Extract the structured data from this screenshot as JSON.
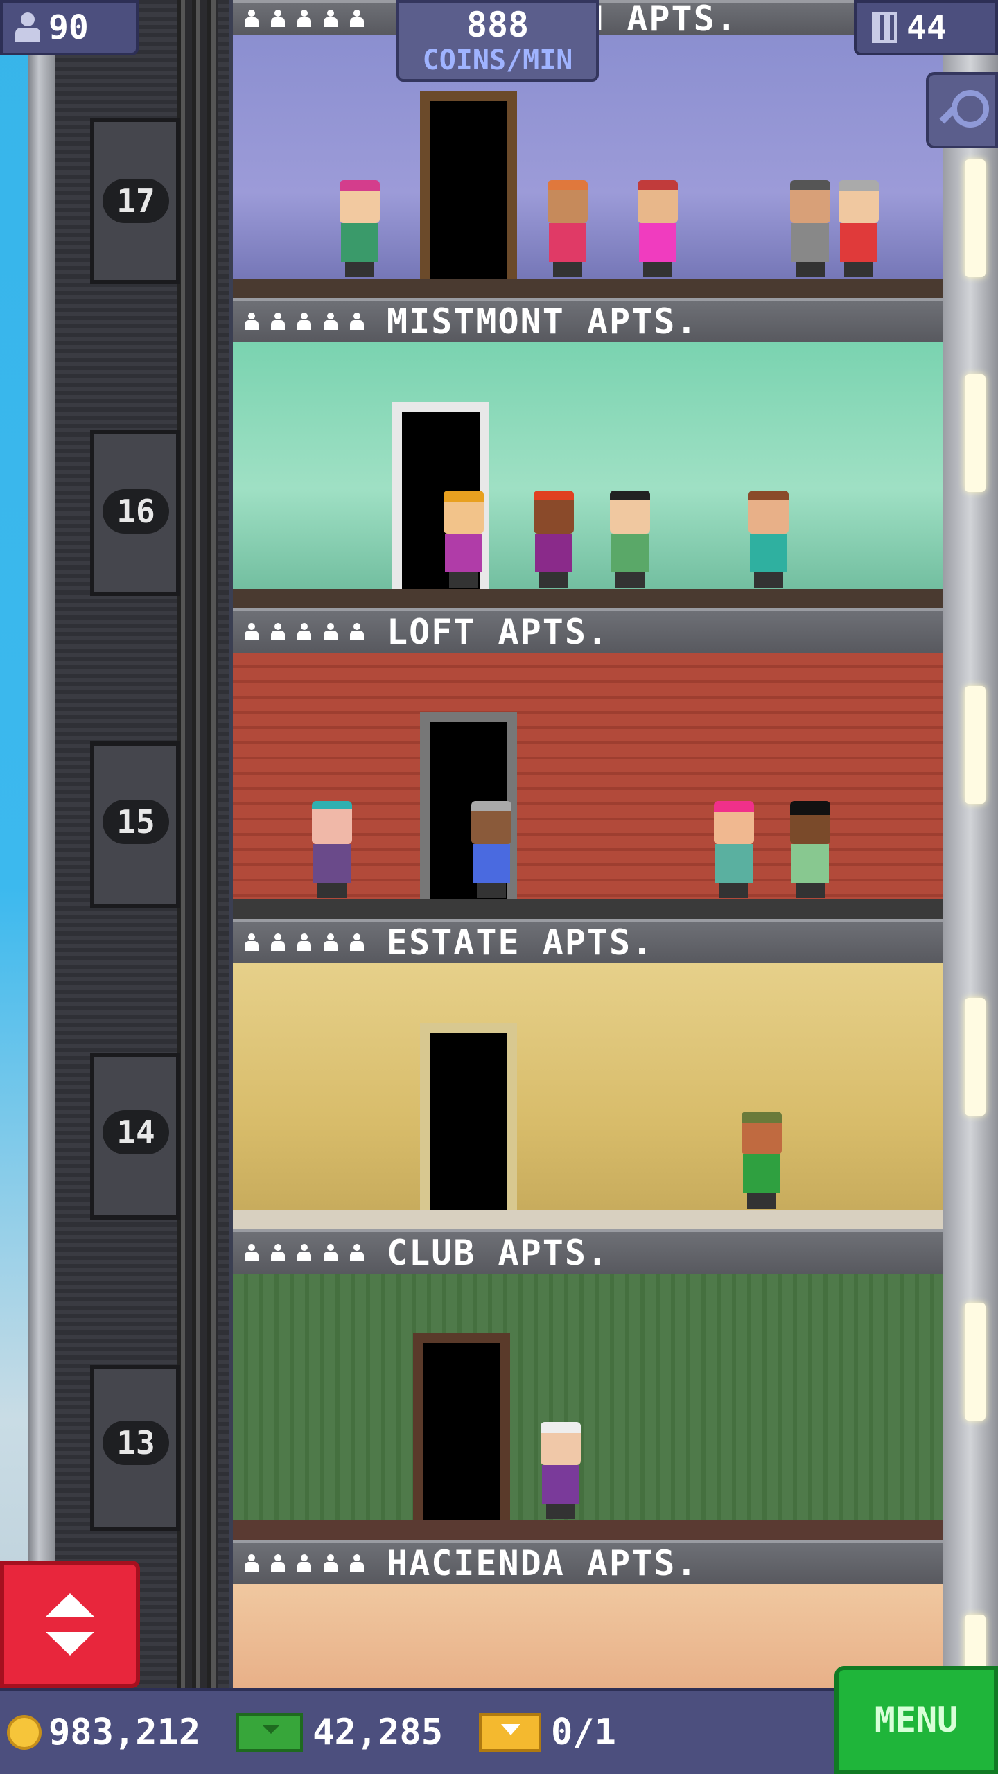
{
  "hud": {
    "population": "90",
    "coins_per_min_value": "888",
    "coins_per_min_label": "COINS/MIN",
    "floor_count": "44"
  },
  "top_floor_partial_name": "WN APTS.",
  "floors": [
    {
      "number": "17",
      "name": "MISTMONT APTS."
    },
    {
      "number": "16",
      "name": "LOFT APTS."
    },
    {
      "number": "15",
      "name": "ESTATE APTS."
    },
    {
      "number": "14",
      "name": "CLUB APTS."
    },
    {
      "number": "13",
      "name": "HACIENDA APTS."
    }
  ],
  "bottom_bar": {
    "coins": "983,212",
    "bux": "42,285",
    "tickets": "0/1",
    "menu_label": "MENU"
  },
  "colors": {
    "hud_panel": "#4c4f7e",
    "coins_label": "#9fb3ff",
    "menu_green": "#1fb53a",
    "elevator_red": "#e8263c"
  },
  "icons": [
    "person-icon",
    "building-icon",
    "magnifier-icon",
    "updown-arrows-icon",
    "coin-icon",
    "bux-icon",
    "ticket-icon",
    "resident-star-icon"
  ]
}
